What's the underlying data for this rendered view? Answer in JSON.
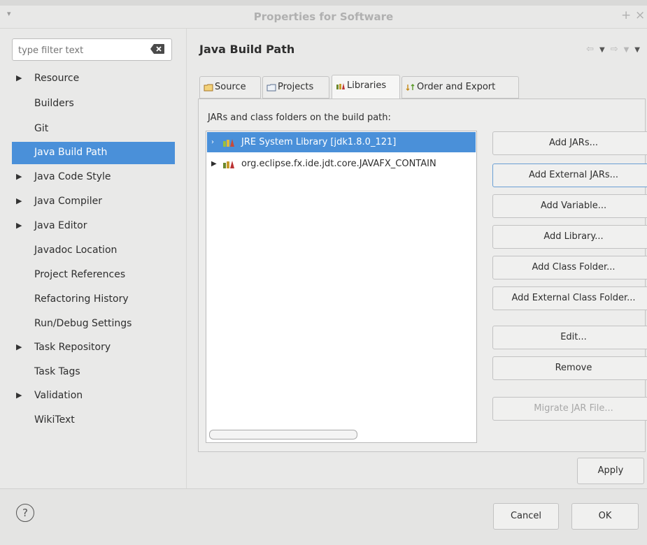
{
  "window": {
    "title": "Properties for Software",
    "plus_glyph": "+",
    "close_glyph": "×"
  },
  "sidebar": {
    "filter_placeholder": "type filter text",
    "items": [
      {
        "label": "Resource",
        "expandable": true
      },
      {
        "label": "Builders",
        "expandable": false
      },
      {
        "label": "Git",
        "expandable": false
      },
      {
        "label": "Java Build Path",
        "expandable": false,
        "selected": true
      },
      {
        "label": "Java Code Style",
        "expandable": true
      },
      {
        "label": "Java Compiler",
        "expandable": true
      },
      {
        "label": "Java Editor",
        "expandable": true
      },
      {
        "label": "Javadoc Location",
        "expandable": false
      },
      {
        "label": "Project References",
        "expandable": false
      },
      {
        "label": "Refactoring History",
        "expandable": false
      },
      {
        "label": "Run/Debug Settings",
        "expandable": false
      },
      {
        "label": "Task Repository",
        "expandable": true
      },
      {
        "label": "Task Tags",
        "expandable": false
      },
      {
        "label": "Validation",
        "expandable": true
      },
      {
        "label": "WikiText",
        "expandable": false
      }
    ]
  },
  "main": {
    "title": "Java Build Path",
    "tabs": [
      {
        "label": "Source",
        "icon": "source-folder-icon"
      },
      {
        "label": "Projects",
        "icon": "projects-icon"
      },
      {
        "label": "Libraries",
        "icon": "libraries-icon",
        "active": true
      },
      {
        "label": "Order and Export",
        "icon": "order-export-icon"
      }
    ],
    "list_label": "JARs and class folders on the build path:",
    "libraries": [
      {
        "label": "JRE System Library [jdk1.8.0_121]",
        "selected": true
      },
      {
        "label": "org.eclipse.fx.ide.jdt.core.JAVAFX_CONTAIN",
        "selected": false
      }
    ],
    "buttons": {
      "add_jars": "Add JARs...",
      "add_external_jars": "Add External JARs...",
      "add_variable": "Add Variable...",
      "add_library": "Add Library...",
      "add_class_folder": "Add Class Folder...",
      "add_external_class_folder": "Add External Class Folder...",
      "edit": "Edit...",
      "remove": "Remove",
      "migrate_jar": "Migrate JAR File..."
    },
    "apply": "Apply"
  },
  "footer": {
    "help_glyph": "?",
    "cancel": "Cancel",
    "ok": "OK"
  },
  "colors": {
    "selection": "#4a90d9",
    "background": "#e9e9e8"
  }
}
